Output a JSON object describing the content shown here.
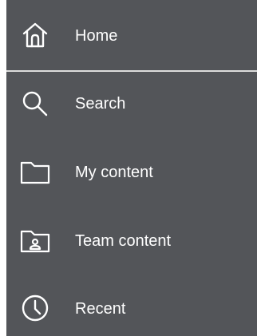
{
  "nav": {
    "background": "#535559",
    "divider_color": "#dcdcdc",
    "items": [
      {
        "label": "Home",
        "icon": "home-icon"
      },
      {
        "label": "Search",
        "icon": "search-icon"
      },
      {
        "label": "My content",
        "icon": "folder-icon"
      },
      {
        "label": "Team content",
        "icon": "team-folder-icon"
      },
      {
        "label": "Recent",
        "icon": "clock-icon"
      }
    ]
  }
}
